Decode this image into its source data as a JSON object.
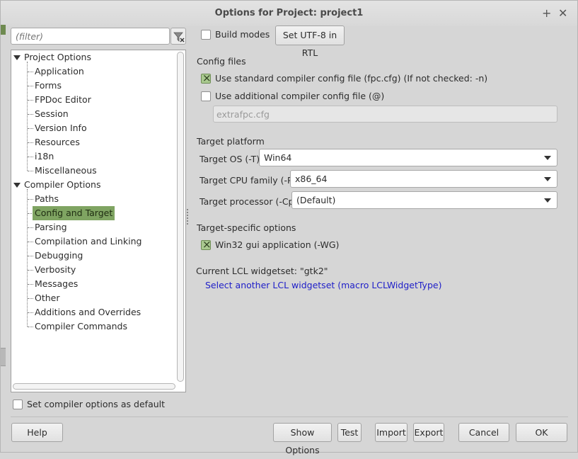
{
  "window": {
    "title": "Options for Project: project1"
  },
  "filter": {
    "placeholder": "(filter)"
  },
  "tree": {
    "groups": [
      {
        "label": "Project Options",
        "items": [
          "Application",
          "Forms",
          "FPDoc Editor",
          "Session",
          "Version Info",
          "Resources",
          "i18n",
          "Miscellaneous"
        ]
      },
      {
        "label": "Compiler Options",
        "items": [
          "Paths",
          "Config and Target",
          "Parsing",
          "Compilation and Linking",
          "Debugging",
          "Verbosity",
          "Messages",
          "Other",
          "Additions and Overrides",
          "Compiler Commands"
        ]
      }
    ],
    "selected": "Config and Target"
  },
  "top": {
    "build_modes_label": "Build modes",
    "build_modes_checked": false,
    "utf8_button": "Set UTF-8 in RTL"
  },
  "config_files": {
    "title": "Config files",
    "standard_label": "Use standard compiler config file (fpc.cfg) (If not checked: -n)",
    "standard_checked": true,
    "additional_label": "Use additional compiler config file (@)",
    "additional_checked": false,
    "additional_value": "extrafpc.cfg"
  },
  "target_platform": {
    "title": "Target platform",
    "os_label": "Target OS (-T)",
    "os_value": "Win64",
    "cpu_label": "Target CPU family (-P)",
    "cpu_value": "x86_64",
    "processor_label": "Target processor (-Cp)",
    "processor_value": "(Default)"
  },
  "target_specific": {
    "title": "Target-specific options",
    "win32_label": "Win32 gui application (-WG)",
    "win32_checked": true
  },
  "lcl": {
    "current": "Current LCL widgetset: \"gtk2\"",
    "select_link": "Select another LCL widgetset (macro LCLWidgetType)"
  },
  "default_option": {
    "label": "Set compiler options as default",
    "checked": false
  },
  "buttons": {
    "help": "Help",
    "show_options": "Show Options",
    "test": "Test",
    "import": "Import",
    "export": "Export",
    "cancel": "Cancel",
    "ok": "OK"
  },
  "colors": {
    "selection": "#7fa462",
    "link": "#1e1ec8",
    "checked": "#a9c98f"
  }
}
